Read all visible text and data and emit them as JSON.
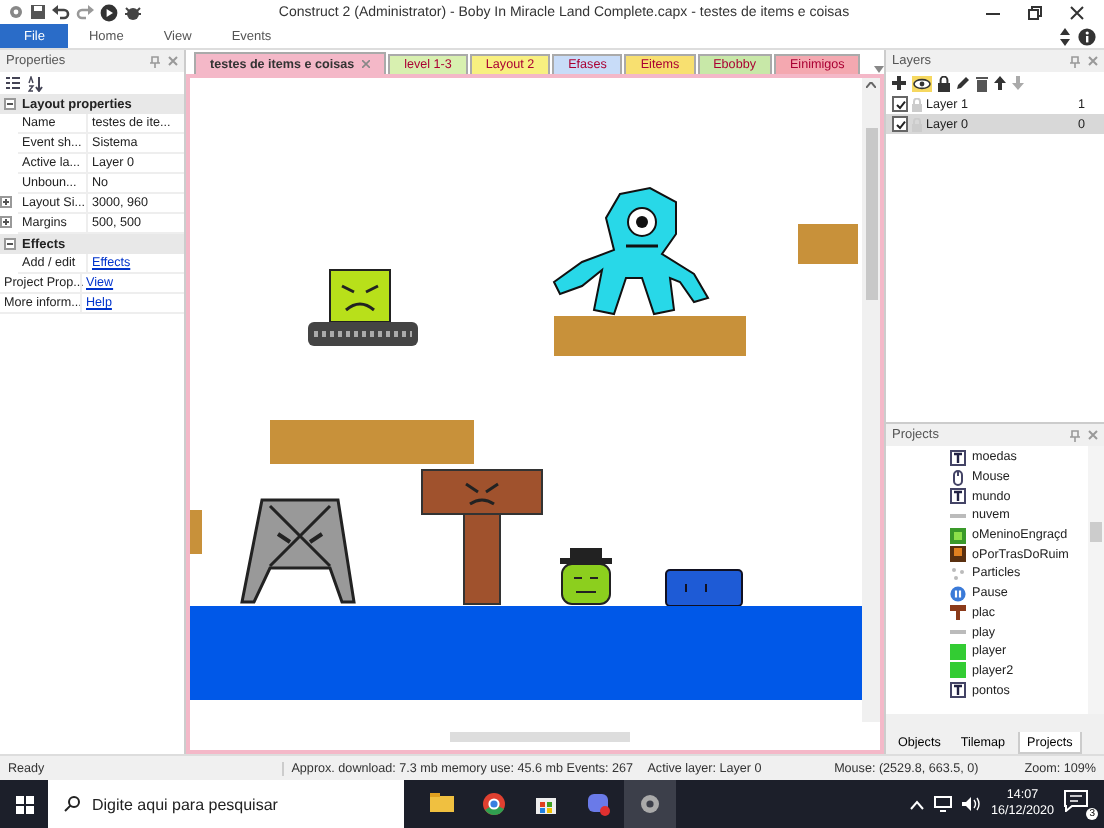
{
  "window": {
    "title": "Construct 2 (Administrator) - Boby In Miracle Land Complete.capx - testes de items e coisas"
  },
  "ribbon_tabs": [
    {
      "label": "File",
      "selected": true
    },
    {
      "label": "Home",
      "selected": false
    },
    {
      "label": "View",
      "selected": false
    },
    {
      "label": "Events",
      "selected": false
    }
  ],
  "properties": {
    "title": "Properties",
    "sections": [
      {
        "label": "Layout properties",
        "expanded": true,
        "rows": [
          {
            "name": "Name",
            "value": "testes de ite...",
            "kind": "text",
            "expandable": false
          },
          {
            "name": "Event sh...",
            "value": "Sistema",
            "kind": "text",
            "expandable": false
          },
          {
            "name": "Active la...",
            "value": "Layer 0",
            "kind": "text",
            "expandable": false
          },
          {
            "name": "Unboun...",
            "value": "No",
            "kind": "text",
            "expandable": false
          },
          {
            "name": "Layout Si...",
            "value": "3000, 960",
            "kind": "text",
            "expandable": true
          },
          {
            "name": "Margins",
            "value": "500, 500",
            "kind": "text",
            "expandable": true
          }
        ]
      },
      {
        "label": "Effects",
        "expanded": true,
        "rows": [
          {
            "name": "Add / edit",
            "value": "Effects",
            "kind": "link",
            "expandable": false
          }
        ]
      }
    ],
    "footer_rows": [
      {
        "name": "Project Prop...",
        "value": "View",
        "kind": "link"
      },
      {
        "name": "More inform...",
        "value": "Help",
        "kind": "link"
      }
    ]
  },
  "document_tabs": [
    {
      "label": "testes de items e coisas",
      "color": "#f4b8c8",
      "selected": true
    },
    {
      "label": "level 1-3",
      "color": "#d8f0b0",
      "selected": false
    },
    {
      "label": "Layout 2",
      "color": "#f8f080",
      "selected": false
    },
    {
      "label": "Efases",
      "color": "#c8dcf8",
      "selected": false
    },
    {
      "label": "Eitems",
      "color": "#f8e070",
      "selected": false
    },
    {
      "label": "Ebobby",
      "color": "#c8e8a8",
      "selected": false
    },
    {
      "label": "Einimigos",
      "color": "#f4a8b0",
      "selected": false
    }
  ],
  "layers": {
    "title": "Layers",
    "rows": [
      {
        "name": "Layer 1",
        "count": "1",
        "checked": true,
        "selected": false
      },
      {
        "name": "Layer 0",
        "count": "0",
        "checked": true,
        "selected": true
      }
    ]
  },
  "projects": {
    "title": "Projects",
    "items": [
      {
        "label": "moedas",
        "kind": "text"
      },
      {
        "label": "Mouse",
        "kind": "mouse"
      },
      {
        "label": "mundo",
        "kind": "text"
      },
      {
        "label": "nuvem",
        "kind": "line"
      },
      {
        "label": "oMeninoEngraçd",
        "kind": "green-sprite"
      },
      {
        "label": "oPorTrasDoRuim",
        "kind": "dark-sprite"
      },
      {
        "label": "Particles",
        "kind": "particles"
      },
      {
        "label": "Pause",
        "kind": "pause"
      },
      {
        "label": "plac",
        "kind": "sign"
      },
      {
        "label": "play",
        "kind": "line"
      },
      {
        "label": "player",
        "kind": "green-square"
      },
      {
        "label": "player2",
        "kind": "green-square"
      },
      {
        "label": "pontos",
        "kind": "text"
      }
    ],
    "tabs": [
      {
        "label": "Objects",
        "selected": false
      },
      {
        "label": "Tilemap",
        "selected": false
      },
      {
        "label": "Projects",
        "selected": true
      }
    ]
  },
  "status_bar": {
    "state": "Ready",
    "stats": "Approx. download: 7.3 mb  memory use: 45.6 mb  Events: 267",
    "active_layer": "Active layer: Layer 0",
    "mouse": "Mouse: (2529.8, 663.5, 0)",
    "zoom": "Zoom: 109%"
  },
  "taskbar": {
    "search_placeholder": "Digite aqui para pesquisar",
    "time": "14:07",
    "date": "16/12/2020",
    "notification_count": "3"
  }
}
